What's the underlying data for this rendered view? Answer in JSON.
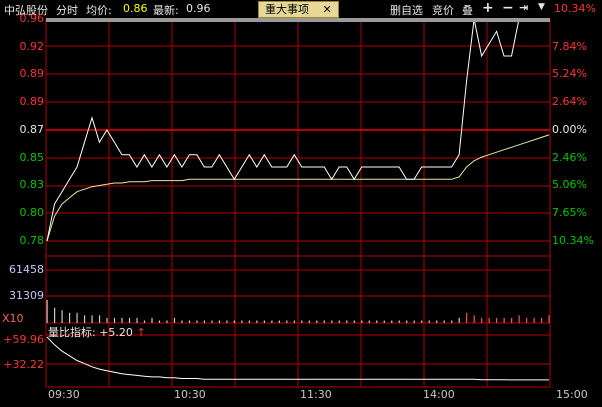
{
  "header": {
    "stock_name": "中弘股份",
    "view": "分时",
    "avg_label": "均价:",
    "avg_value": "0.86",
    "last_label": "最新:",
    "last_value": "0.96",
    "news_button": "重大事项",
    "news_close": "✕",
    "del_watch": "删自选",
    "compete": "竞价",
    "overlay": "叠",
    "zoom_in_icon": "plus-icon",
    "zoom_out_icon": "minus-icon",
    "jump_icon": "jump-right-icon",
    "menu_icon": "dropdown-icon"
  },
  "price_axis": [
    "0.96",
    "0.92",
    "0.89",
    "0.87",
    "0.85",
    "0.83",
    "0.80",
    "0.78"
  ],
  "pct_axis_up": [
    "10.34%",
    "7.84%",
    "5.24%",
    "2.64%"
  ],
  "pct_axis_zero": "0.00%",
  "pct_axis_down": [
    "2.46%",
    "5.06%",
    "7.65%",
    "10.34%"
  ],
  "volume_axis": [
    "61458",
    "31309"
  ],
  "volume_scale": "X10",
  "ratio_indicator": {
    "label": "量比指标:",
    "value": "+5.20",
    "arrow": "↑",
    "axis": [
      "+59.96",
      "+32.22"
    ]
  },
  "time_axis": [
    "09:30",
    "10:30",
    "11:30",
    "14:00",
    "15:00"
  ],
  "colors": {
    "grid": "#b40000",
    "price_line": "#ffffff",
    "avg_line": "#e8e8a0",
    "up": "#ff3232",
    "down": "#00c800",
    "news_bg": "#e8d898"
  },
  "chart_data": {
    "type": "line",
    "title": "",
    "xlabel": "",
    "ylabel": "",
    "x_ticks": [
      "09:30",
      "10:30",
      "11:30",
      "14:00",
      "15:00"
    ],
    "ylim": [
      0.78,
      0.96
    ],
    "prev_close": 0.87,
    "series": [
      {
        "name": "",
        "kind": "price",
        "values": [
          0.78,
          0.81,
          0.82,
          0.83,
          0.84,
          0.86,
          0.88,
          0.86,
          0.87,
          0.86,
          0.85,
          0.85,
          0.84,
          0.85,
          0.84,
          0.85,
          0.84,
          0.85,
          0.84,
          0.85,
          0.85,
          0.84,
          0.84,
          0.85,
          0.84,
          0.83,
          0.84,
          0.85,
          0.84,
          0.85,
          0.84,
          0.84,
          0.84,
          0.85,
          0.84,
          0.84,
          0.84,
          0.84,
          0.83,
          0.84,
          0.84,
          0.83,
          0.84,
          0.84,
          0.84,
          0.84,
          0.84,
          0.84,
          0.83,
          0.83,
          0.84,
          0.84,
          0.84,
          0.84,
          0.84,
          0.85,
          0.91,
          0.96,
          0.93,
          0.94,
          0.95,
          0.93,
          0.93,
          0.96,
          0.96,
          0.96,
          0.96,
          0.96
        ]
      },
      {
        "name": "",
        "kind": "average",
        "values": [
          0.78,
          0.8,
          0.81,
          0.815,
          0.82,
          0.822,
          0.824,
          0.825,
          0.826,
          0.827,
          0.827,
          0.828,
          0.828,
          0.828,
          0.829,
          0.829,
          0.829,
          0.829,
          0.829,
          0.83,
          0.83,
          0.83,
          0.83,
          0.83,
          0.83,
          0.83,
          0.83,
          0.83,
          0.83,
          0.83,
          0.83,
          0.83,
          0.83,
          0.83,
          0.83,
          0.83,
          0.83,
          0.83,
          0.83,
          0.83,
          0.83,
          0.83,
          0.83,
          0.83,
          0.83,
          0.83,
          0.83,
          0.83,
          0.83,
          0.83,
          0.83,
          0.83,
          0.83,
          0.83,
          0.83,
          0.832,
          0.84,
          0.845,
          0.848,
          0.85,
          0.852,
          0.854,
          0.856,
          0.858,
          0.86,
          0.862,
          0.864,
          0.866
        ]
      }
    ],
    "volume": [
      9,
      6,
      5,
      4,
      4,
      3,
      3,
      3,
      2,
      2,
      2,
      2,
      2,
      1,
      2,
      1,
      1,
      2,
      1,
      1,
      1,
      1,
      1,
      1,
      1,
      1,
      1,
      1,
      1,
      1,
      1,
      1,
      1,
      1,
      1,
      1,
      1,
      1,
      1,
      1,
      1,
      1,
      1,
      1,
      1,
      1,
      1,
      1,
      1,
      1,
      1,
      1,
      1,
      1,
      1,
      2,
      4,
      3,
      2,
      2,
      2,
      2,
      2,
      3,
      2,
      2,
      2,
      3
    ],
    "volume_ratio": [
      59.96,
      50,
      42,
      36,
      30,
      26,
      22,
      19,
      17,
      15,
      13,
      12,
      11,
      10,
      9,
      9,
      8,
      8,
      7,
      7,
      7,
      6,
      6,
      6,
      6,
      6,
      6,
      6,
      6,
      6,
      6,
      6,
      6,
      6,
      6,
      6,
      6,
      6,
      6,
      6,
      6,
      6,
      6,
      6,
      6,
      6,
      6,
      6,
      6,
      6,
      6,
      6,
      6,
      6,
      6,
      6,
      6,
      6,
      5.5,
      5.4,
      5.3,
      5.3,
      5.2,
      5.2,
      5.2,
      5.2,
      5.2,
      5.2
    ],
    "volume_ratio_ylim": [
      0,
      60
    ]
  }
}
